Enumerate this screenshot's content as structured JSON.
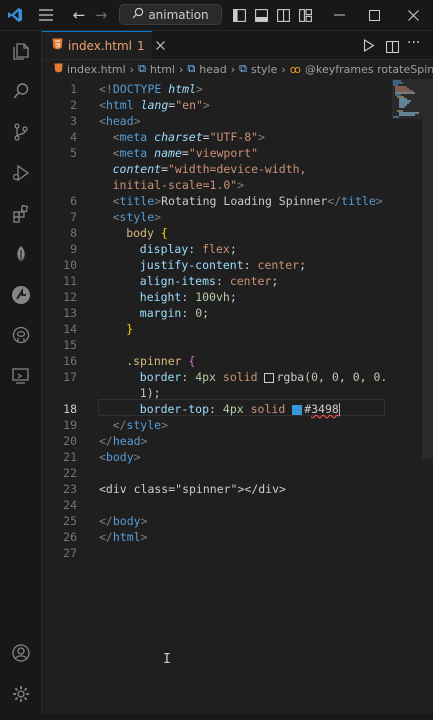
{
  "titlebar": {
    "search_label": "animation"
  },
  "tab": {
    "name": "index.html",
    "badge": "1"
  },
  "breadcrumb": [
    "index.html",
    "html",
    "head",
    "style",
    "@keyframes rotateSpinner"
  ],
  "editor": {
    "lines": [
      {
        "n": "1",
        "cls": "",
        "html": "<span class='t-punct'>&lt;!</span><span class='t-tag'>DOCTYPE</span> <span class='t-attr' style='font-style:italic'>html</span><span class='t-punct'>&gt;</span>",
        "indent": 0
      },
      {
        "n": "2",
        "cls": "",
        "html": "<span class='t-punct'>&lt;</span><span class='t-tag'>html</span> <span class='t-attr' style='font-style:italic'>lang</span>=<span class='t-str'>\"en\"</span><span class='t-punct'>&gt;</span>",
        "indent": 0
      },
      {
        "n": "3",
        "cls": "",
        "html": "<span class='t-punct'>&lt;</span><span class='t-tag'>head</span><span class='t-punct'>&gt;</span>",
        "indent": 0
      },
      {
        "n": "4",
        "cls": "",
        "html": "<span class='t-punct'>&lt;</span><span class='t-tag'>meta</span> <span class='t-attr' style='font-style:italic'>charset</span>=<span class='t-str'>\"UTF-8\"</span><span class='t-punct'>&gt;</span>",
        "indent": 1
      },
      {
        "n": "5",
        "cls": "",
        "html": "<span class='t-punct'>&lt;</span><span class='t-tag'>meta</span> <span class='t-attr' style='font-style:italic'>name</span>=<span class='t-str'>\"viewport\"</span>",
        "indent": 1
      },
      {
        "n": "",
        "cls": "",
        "html": "<span class='t-attr' style='font-style:italic'>content</span>=<span class='t-str'>\"width=device-width,</span>",
        "indent": 1
      },
      {
        "n": "",
        "cls": "",
        "html": "<span class='t-str'>initial-scale=1.0\"</span><span class='t-punct'>&gt;</span>",
        "indent": 1
      },
      {
        "n": "6",
        "cls": "",
        "html": "<span class='t-punct'>&lt;</span><span class='t-tag'>title</span><span class='t-punct'>&gt;</span><span class='t-text'>Rotating Loading Spinner</span><span class='t-punct'>&lt;/</span><span class='t-tag'>title</span><span class='t-punct'>&gt;</span>",
        "indent": 1
      },
      {
        "n": "7",
        "cls": "",
        "html": "<span class='t-punct'>&lt;</span><span class='t-tag'>style</span><span class='t-punct'>&gt;</span>",
        "indent": 1
      },
      {
        "n": "8",
        "cls": "",
        "html": "<span class='t-sel'>body</span> <span class='t-brace2'>{</span>",
        "indent": 2
      },
      {
        "n": "9",
        "cls": "",
        "html": "<span class='t-prop'>display</span>: <span class='t-val'>flex</span>;",
        "indent": 3
      },
      {
        "n": "10",
        "cls": "",
        "html": "<span class='t-prop'>justify-content</span>: <span class='t-val'>center</span>;",
        "indent": 3
      },
      {
        "n": "11",
        "cls": "",
        "html": "<span class='t-prop'>align-items</span>: <span class='t-val'>center</span>;",
        "indent": 3
      },
      {
        "n": "12",
        "cls": "",
        "html": "<span class='t-prop'>height</span>: <span class='t-num'>100vh</span>;",
        "indent": 3
      },
      {
        "n": "13",
        "cls": "",
        "html": "<span class='t-prop'>margin</span>: <span class='t-num'>0</span>;",
        "indent": 3
      },
      {
        "n": "14",
        "cls": "",
        "html": "<span class='t-brace2'>}</span>",
        "indent": 2
      },
      {
        "n": "15",
        "cls": "",
        "html": "",
        "indent": 0
      },
      {
        "n": "16",
        "cls": "",
        "html": "<span class='t-cls'>.spinner</span> <span class='t-brace'>{</span>",
        "indent": 2
      },
      {
        "n": "17",
        "cls": "",
        "html": "<span class='t-prop'>border</span>: <span class='t-num'>4px</span> <span class='t-val'>solid</span> <span class='swatch' style='background:transparent'></span><span class='t-text'>rgba(</span><span class='t-num'>0</span>, <span class='t-num'>0</span>, <span class='t-num'>0</span>, <span class='t-num'>0.</span>",
        "indent": 3
      },
      {
        "n": "",
        "cls": "",
        "html": "<span class='t-num'>1</span><span class='t-text'>)</span>;",
        "indent": 3
      },
      {
        "n": "18",
        "cls": "cur",
        "html": "<span class='t-prop'>border-top</span>: <span class='t-num'>4px</span> <span class='t-val'>solid</span> <span class='swatch' style='background:#3498db;border-color:#3498db'></span><span class='t-text'>#</span><span class='t-text squiggle'>3498</span><span class='cursor-bar'></span>",
        "indent": 3
      },
      {
        "n": "19",
        "cls": "",
        "html": "<span class='t-punct'>&lt;/</span><span class='t-tag'>style</span><span class='t-punct'>&gt;</span>",
        "indent": 1
      },
      {
        "n": "20",
        "cls": "",
        "html": "<span class='t-punct'>&lt;/</span><span class='t-tag'>head</span><span class='t-punct'>&gt;</span>",
        "indent": 0
      },
      {
        "n": "21",
        "cls": "",
        "html": "<span class='t-punct'>&lt;</span><span class='t-tag'>body</span><span class='t-punct'>&gt;</span>",
        "indent": 0
      },
      {
        "n": "22",
        "cls": "",
        "html": "",
        "indent": 0
      },
      {
        "n": "23",
        "cls": "",
        "html": "<span class='t-text'>&lt;div class=\"spinner\"&gt;&lt;/div&gt;</span>",
        "indent": 0
      },
      {
        "n": "24",
        "cls": "",
        "html": "",
        "indent": 0
      },
      {
        "n": "25",
        "cls": "",
        "html": "<span class='t-punct'>&lt;/</span><span class='t-tag'>body</span><span class='t-punct'>&gt;</span>",
        "indent": 0
      },
      {
        "n": "26",
        "cls": "",
        "html": "<span class='t-punct'>&lt;/</span><span class='t-tag'>html</span><span class='t-punct'>&gt;</span>",
        "indent": 0
      },
      {
        "n": "27",
        "cls": "",
        "html": "",
        "indent": 0
      }
    ]
  },
  "colors": {
    "accent": "#0078d4",
    "tab_html_icon": "#e37933",
    "activity_icon": "#858585"
  }
}
